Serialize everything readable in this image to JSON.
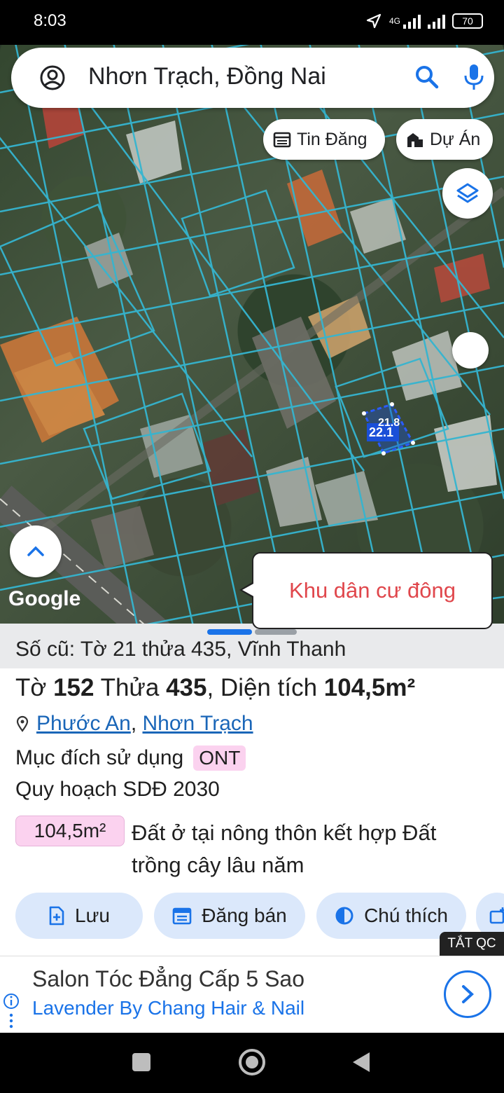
{
  "status_bar": {
    "time": "8:03",
    "network": "4G",
    "battery": "70"
  },
  "search": {
    "query": "Nhơn Trạch, Đồng Nai"
  },
  "chips": {
    "listings": "Tin Đăng",
    "projects": "Dự Án"
  },
  "map": {
    "parcel_dim_a": "22.1",
    "parcel_dim_b": "21.8",
    "attribution": "Google",
    "callout": "Khu dân cư đông"
  },
  "parcel": {
    "old_ref": "Số cũ: Tờ 21 thửa 435, Vĩnh Thanh",
    "sheet_label": "Tờ",
    "sheet_no": "152",
    "lot_label": "Thửa",
    "lot_no": "435",
    "area_label": ", Diện tích",
    "area": "104,5m²",
    "ward": "Phước An",
    "district": "Nhơn Trạch",
    "use_label": "Mục đích sử dụng",
    "use_code": "ONT",
    "plan_label": "Quy hoạch SDĐ 2030",
    "plan_area": "104,5m²",
    "plan_desc": "Đất ở tại nông thôn kết hợp Đất trồng cây lâu năm"
  },
  "actions": {
    "save": "Lưu",
    "post": "Đăng bán",
    "legend": "Chú thích"
  },
  "ad": {
    "hide_label": "TẮT QC",
    "title": "Salon Tóc Đẳng Cấp 5 Sao",
    "subtitle": "Lavender By Chang Hair & Nail"
  },
  "colors": {
    "accent": "#1a73e8",
    "badge": "#fbd2ef",
    "callout_text": "#e0474c",
    "parcel_lines": "#35b5d0"
  }
}
